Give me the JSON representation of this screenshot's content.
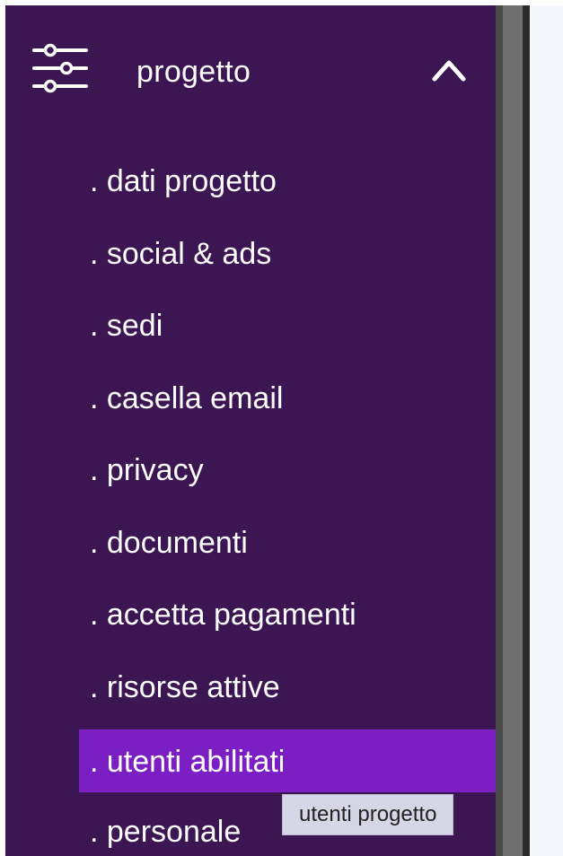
{
  "sidebar": {
    "section": {
      "icon": "sliders-icon",
      "label": "progetto",
      "toggle_icon": "chevron-up-icon",
      "expanded": true
    },
    "items": [
      {
        "label": ". dati progetto",
        "active": false
      },
      {
        "label": ". social & ads",
        "active": false
      },
      {
        "label": ". sedi",
        "active": false
      },
      {
        "label": ". casella email",
        "active": false
      },
      {
        "label": ". privacy",
        "active": false
      },
      {
        "label": ". documenti",
        "active": false
      },
      {
        "label": ". accetta pagamenti",
        "active": false
      },
      {
        "label": ". risorse attive",
        "active": false
      },
      {
        "label": ". utenti abilitati",
        "active": true
      },
      {
        "label": ". personale",
        "active": false
      }
    ]
  },
  "tooltip": {
    "text": "utenti progetto"
  },
  "colors": {
    "sidebar_bg": "#3c1653",
    "active_item_bg": "#7b1ec3",
    "text": "#ffffff",
    "tooltip_bg": "#d6d6e6",
    "content_bg": "#f5f7fd"
  }
}
